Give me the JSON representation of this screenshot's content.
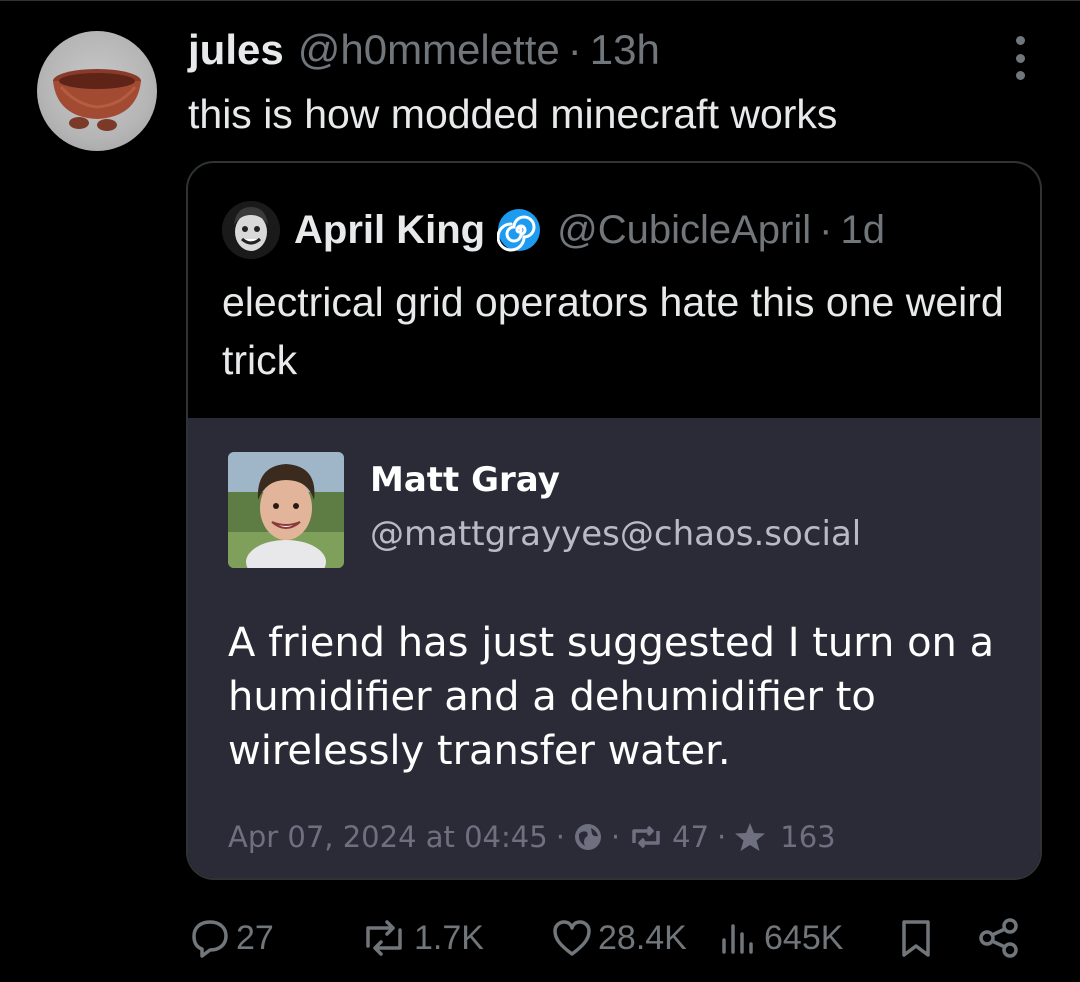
{
  "tweet": {
    "author_name": "jules",
    "author_handle": "@h0mmelette",
    "time": "13h",
    "text": "this is how modded minecraft works",
    "avatar_icon": "bowl-avatar-image",
    "more_icon": "more-vertical-icon"
  },
  "quote": {
    "author_name": "April King",
    "badge_icon": "spiral-icon",
    "author_handle": "@CubicleApril",
    "time": "1d",
    "text": "electrical grid operators hate this one weird trick",
    "embedded_post": {
      "author_name": "Matt Gray",
      "author_handle": "@mattgrayyes@chaos.social",
      "text": "A friend has just suggested I turn on a humidifier and a dehumidifier to wirelessly transfer water.",
      "date": "Apr 07, 2024 at 04:45",
      "boosts": "47",
      "favourites": "163",
      "background_color": "#2b2b37"
    }
  },
  "actions": {
    "replies": "27",
    "reposts": "1.7K",
    "likes": "28.4K",
    "views": "645K"
  },
  "colors": {
    "background": "#000000",
    "text": "#e7e9ea",
    "secondary": "#71767b",
    "accent": "#1d9bf0",
    "border": "#2f3336"
  }
}
